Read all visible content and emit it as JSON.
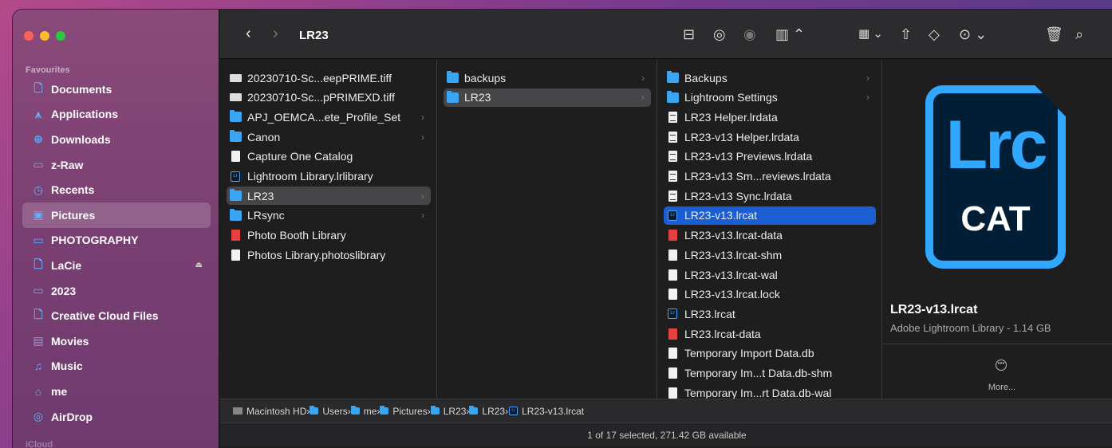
{
  "window": {
    "title": "LR23"
  },
  "colors": {
    "accent": "#1b5ed4",
    "folder": "#39a5f3",
    "lrc_blue": "#31a8ff",
    "lrc_bg": "#001e36"
  },
  "sidebar": {
    "heading": "Favourites",
    "items": [
      {
        "label": "Documents",
        "icon": "document-icon"
      },
      {
        "label": "Applications",
        "icon": "applications-icon"
      },
      {
        "label": "Downloads",
        "icon": "downloads-icon"
      },
      {
        "label": "z-Raw",
        "icon": "folder-icon"
      },
      {
        "label": "Recents",
        "icon": "clock-icon"
      },
      {
        "label": "Pictures",
        "icon": "pictures-icon",
        "selected": true
      },
      {
        "label": "PHOTOGRAPHY",
        "icon": "folder-icon"
      },
      {
        "label": "LaCie",
        "icon": "drive-icon",
        "eject": true
      },
      {
        "label": "2023",
        "icon": "folder-icon"
      },
      {
        "label": "Creative Cloud Files",
        "icon": "document-icon"
      },
      {
        "label": "Movies",
        "icon": "movies-icon"
      },
      {
        "label": "Music",
        "icon": "music-icon"
      },
      {
        "label": "me",
        "icon": "home-icon"
      },
      {
        "label": "AirDrop",
        "icon": "airdrop-icon"
      }
    ],
    "footer_partial": "iCloud"
  },
  "toolbar": {
    "back": "‹",
    "forward": "›",
    "icons": [
      "network-icon",
      "airdrop-icon",
      "share-users-icon",
      "column-view-icon",
      "group-icon",
      "share-icon",
      "tag-icon",
      "more-actions-icon",
      "trash-icon",
      "search-icon"
    ]
  },
  "column1": [
    {
      "label": "20230710-Sc...eepPRIME.tiff",
      "icon": "image"
    },
    {
      "label": "20230710-Sc...pPRIMEXD.tiff",
      "icon": "image"
    },
    {
      "label": "APJ_OEMCA...ete_Profile_Set",
      "icon": "folder",
      "chevron": true
    },
    {
      "label": "Canon",
      "icon": "folder",
      "chevron": true
    },
    {
      "label": "Capture One Catalog",
      "icon": "doc"
    },
    {
      "label": "Lightroom Library.lrlibrary",
      "icon": "lrc"
    },
    {
      "label": "LR23",
      "icon": "folder",
      "chevron": true,
      "selected": "gray"
    },
    {
      "label": "LRsync",
      "icon": "folder",
      "chevron": true
    },
    {
      "label": "Photo Booth Library",
      "icon": "docred"
    },
    {
      "label": "Photos Library.photoslibrary",
      "icon": "doc"
    }
  ],
  "column2": [
    {
      "label": "backups",
      "icon": "folder",
      "chevron": true
    },
    {
      "label": "LR23",
      "icon": "folder",
      "chevron": true,
      "selected": "gray"
    }
  ],
  "column3": [
    {
      "label": "Backups",
      "icon": "folder",
      "chevron": true
    },
    {
      "label": "Lightroom Settings",
      "icon": "folder",
      "chevron": true
    },
    {
      "label": "LR23 Helper.lrdata",
      "icon": "doclines"
    },
    {
      "label": "LR23-v13 Helper.lrdata",
      "icon": "doclines"
    },
    {
      "label": "LR23-v13 Previews.lrdata",
      "icon": "doclines"
    },
    {
      "label": "LR23-v13 Sm...reviews.lrdata",
      "icon": "doclines"
    },
    {
      "label": "LR23-v13 Sync.lrdata",
      "icon": "doclines"
    },
    {
      "label": "LR23-v13.lrcat",
      "icon": "lrc",
      "selected": "blue"
    },
    {
      "label": "LR23-v13.lrcat-data",
      "icon": "docred"
    },
    {
      "label": "LR23-v13.lrcat-shm",
      "icon": "doc"
    },
    {
      "label": "LR23-v13.lrcat-wal",
      "icon": "doc"
    },
    {
      "label": "LR23-v13.lrcat.lock",
      "icon": "doc"
    },
    {
      "label": "LR23.lrcat",
      "icon": "lrc"
    },
    {
      "label": "LR23.lrcat-data",
      "icon": "docred"
    },
    {
      "label": "Temporary Import Data.db",
      "icon": "doc"
    },
    {
      "label": "Temporary Im...t Data.db-shm",
      "icon": "doc"
    },
    {
      "label": "Temporary Im...rt Data.db-wal",
      "icon": "doc"
    }
  ],
  "preview": {
    "icon_text": "Lrc",
    "icon_subtext": "CAT",
    "name": "LR23-v13.lrcat",
    "kind": "Adobe Lightroom Library - 1.14 GB",
    "more": "More..."
  },
  "pathbar": [
    "Macintosh HD",
    "Users",
    "me",
    "Pictures",
    "LR23",
    "LR23",
    "LR23-v13.lrcat"
  ],
  "status": "1 of 17 selected, 271.42 GB available"
}
